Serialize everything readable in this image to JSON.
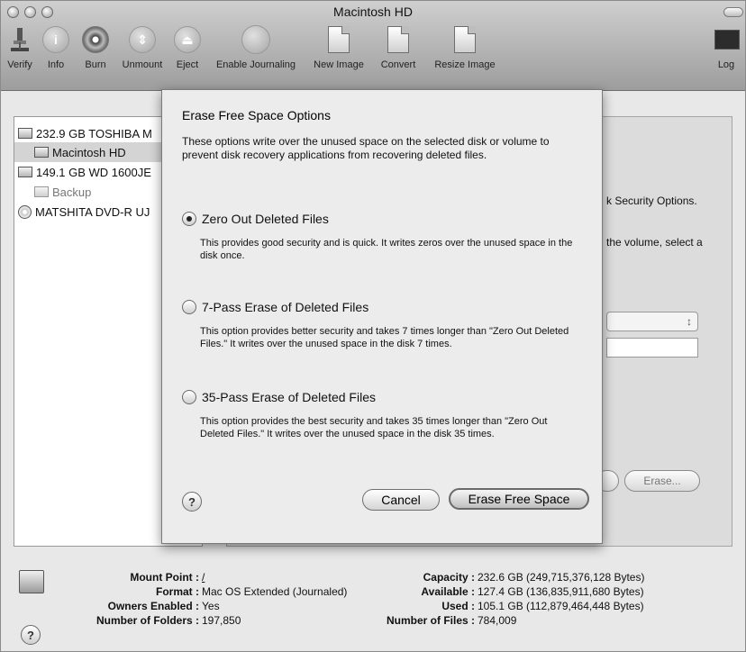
{
  "window": {
    "title": "Macintosh HD"
  },
  "toolbar": {
    "items": [
      {
        "label": "Verify",
        "icon": "microscope-icon"
      },
      {
        "label": "Info",
        "icon": "info-icon"
      },
      {
        "label": "Burn",
        "icon": "burn-icon"
      },
      {
        "label": "Unmount",
        "icon": "unmount-icon"
      },
      {
        "label": "Eject",
        "icon": "eject-icon"
      },
      {
        "label": "Enable Journaling",
        "icon": "journaling-icon"
      },
      {
        "label": "New Image",
        "icon": "new-image-icon"
      },
      {
        "label": "Convert",
        "icon": "convert-icon"
      },
      {
        "label": "Resize Image",
        "icon": "resize-image-icon"
      }
    ],
    "log_label": "Log"
  },
  "sidebar": {
    "items": [
      {
        "label": "232.9 GB TOSHIBA M",
        "icon": "hard-disk-icon"
      },
      {
        "label": "Macintosh HD",
        "icon": "volume-icon"
      },
      {
        "label": "149.1 GB WD 1600JE",
        "icon": "hard-disk-icon"
      },
      {
        "label": "Backup",
        "icon": "volume-icon"
      },
      {
        "label": "MATSHITA DVD-R UJ",
        "icon": "dvd-icon"
      }
    ]
  },
  "background": {
    "security_options_text": "k Security Options.",
    "volume_text": "the volume, select a",
    "erase_button": "Erase..."
  },
  "sheet": {
    "title": "Erase Free Space Options",
    "description": "These options write over the unused space on the selected disk or volume to prevent disk recovery applications from recovering deleted files.",
    "options": [
      {
        "label": "Zero Out Deleted Files",
        "description": "This provides good security and is quick. It writes zeros over the unused space in the disk once.",
        "selected": true
      },
      {
        "label": "7-Pass Erase of Deleted Files",
        "description": "This option provides better security and takes 7 times longer than \"Zero Out Deleted Files.\" It writes over the unused space in the disk 7 times.",
        "selected": false
      },
      {
        "label": "35-Pass Erase of Deleted Files",
        "description": "This option provides the best security and takes 35 times longer than \"Zero Out Deleted Files.\" It writes over the unused space in the disk 35 times.",
        "selected": false
      }
    ],
    "help_label": "?",
    "cancel_label": "Cancel",
    "confirm_label": "Erase Free Space"
  },
  "info": {
    "mount_point_label": "Mount Point :",
    "mount_point": "/",
    "format_label": "Format :",
    "format": "Mac OS Extended (Journaled)",
    "owners_label": "Owners Enabled :",
    "owners": "Yes",
    "folders_label": "Number of Folders :",
    "folders": "197,850",
    "capacity_label": "Capacity :",
    "capacity": "232.6 GB (249,715,376,128 Bytes)",
    "available_label": "Available :",
    "available": "127.4 GB (136,835,911,680 Bytes)",
    "used_label": "Used :",
    "used": "105.1 GB (112,879,464,448 Bytes)",
    "files_label": "Number of Files :",
    "files": "784,009",
    "help_label": "?"
  }
}
